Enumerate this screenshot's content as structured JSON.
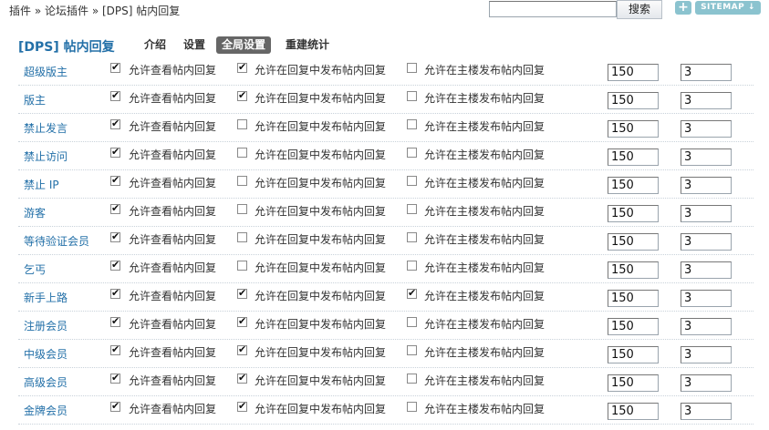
{
  "breadcrumb": [
    "插件",
    "论坛插件",
    "[DPS] 帖内回复"
  ],
  "breadcrumb_sep": " » ",
  "search": {
    "value": "",
    "button_label": "搜索"
  },
  "add_label": "+",
  "sitemap_label": "SITEMAP",
  "plugin_title": "[DPS] 帖内回复",
  "tabs": [
    {
      "label": "介绍",
      "active": false
    },
    {
      "label": "设置",
      "active": false
    },
    {
      "label": "全局设置",
      "active": true
    },
    {
      "label": "重建统计",
      "active": false
    }
  ],
  "option_labels": {
    "view": "允许查看帖内回复",
    "reply_post": "允许在回复中发布帖内回复",
    "main_post": "允许在主楼发布帖内回复"
  },
  "groups": [
    {
      "name": "超级版主",
      "view": true,
      "reply_post": true,
      "main_post": false,
      "limit_a": "150",
      "limit_b": "3"
    },
    {
      "name": "版主",
      "view": true,
      "reply_post": true,
      "main_post": false,
      "limit_a": "150",
      "limit_b": "3"
    },
    {
      "name": "禁止发言",
      "view": true,
      "reply_post": false,
      "main_post": false,
      "limit_a": "150",
      "limit_b": "3"
    },
    {
      "name": "禁止访问",
      "view": true,
      "reply_post": false,
      "main_post": false,
      "limit_a": "150",
      "limit_b": "3"
    },
    {
      "name": "禁止 IP",
      "view": true,
      "reply_post": false,
      "main_post": false,
      "limit_a": "150",
      "limit_b": "3"
    },
    {
      "name": "游客",
      "view": true,
      "reply_post": false,
      "main_post": false,
      "limit_a": "150",
      "limit_b": "3"
    },
    {
      "name": "等待验证会员",
      "view": true,
      "reply_post": false,
      "main_post": false,
      "limit_a": "150",
      "limit_b": "3"
    },
    {
      "name": "乞丐",
      "view": true,
      "reply_post": false,
      "main_post": false,
      "limit_a": "150",
      "limit_b": "3"
    },
    {
      "name": "新手上路",
      "view": true,
      "reply_post": true,
      "main_post": true,
      "limit_a": "150",
      "limit_b": "3"
    },
    {
      "name": "注册会员",
      "view": true,
      "reply_post": true,
      "main_post": false,
      "limit_a": "150",
      "limit_b": "3"
    },
    {
      "name": "中级会员",
      "view": true,
      "reply_post": true,
      "main_post": false,
      "limit_a": "150",
      "limit_b": "3"
    },
    {
      "name": "高级会员",
      "view": true,
      "reply_post": true,
      "main_post": false,
      "limit_a": "150",
      "limit_b": "3"
    },
    {
      "name": "金牌会员",
      "view": true,
      "reply_post": true,
      "main_post": false,
      "limit_a": "150",
      "limit_b": "3"
    }
  ],
  "colors": {
    "link": "#2370a8",
    "active_tab_bg": "#666666",
    "sitemap_bg": "#8bc3cf"
  }
}
